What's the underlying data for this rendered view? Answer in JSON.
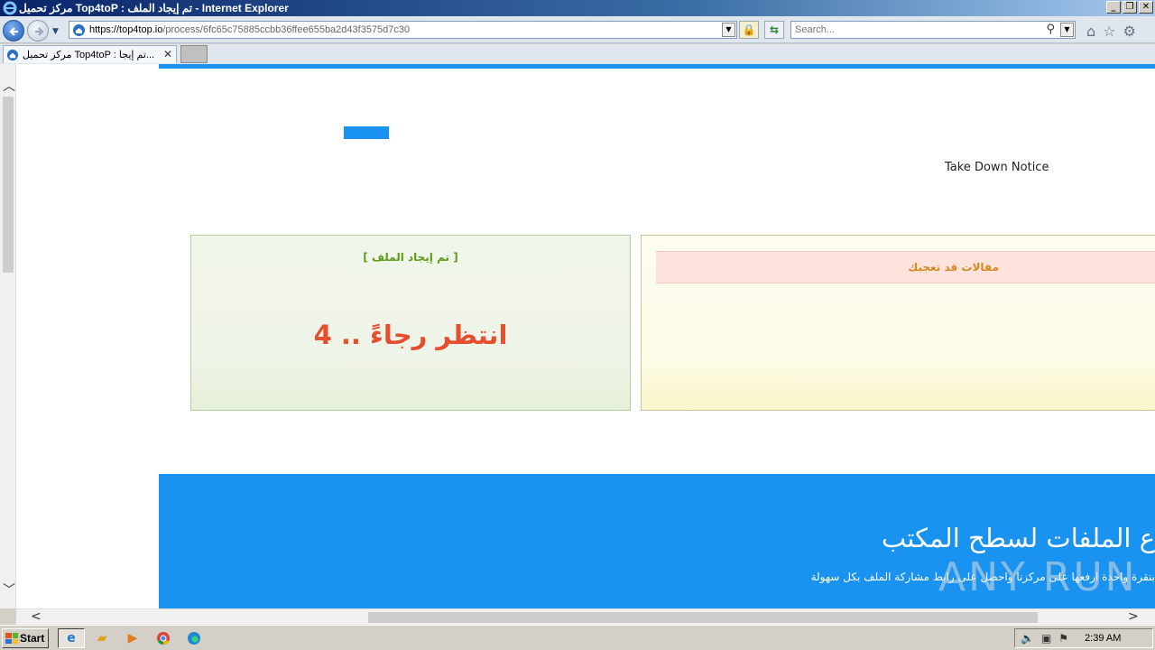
{
  "window": {
    "title": "مركز تحميل Top4toP : تم إيجاد الملف - Internet Explorer",
    "controls": [
      "_",
      "❐",
      "✕"
    ]
  },
  "toolbar": {
    "url_host": "https://top4top.io",
    "url_path": "/process/6fc65c75885ccbb36ffee655ba2d43f3575d7c30",
    "search_placeholder": "Search..."
  },
  "tabs": [
    {
      "label": "مركز تحميل Top4toP : تم إيجا..."
    }
  ],
  "page": {
    "take_down": "Take Down Notice",
    "file_found": "[ تم إيجاد الملف ]",
    "wait_text": "انتظر رجاءً .. 4",
    "articles_header": "مقالات قد تعجبك",
    "banner_title": "ع الملفات لسطح المكتب",
    "banner_subtitle": "بنقرة واحدة ارفعها على مركزنا واحصل على رابط مشاركة الملف بكل سهولة",
    "watermark": "ANY RUN"
  },
  "taskbar": {
    "start_label": "Start",
    "clock": "2:39 AM"
  },
  "colors": {
    "accent_blue": "#1a93f0",
    "found_green": "#5d9b1a",
    "wait_red": "#e4502f",
    "articles_orange": "#d68a22"
  }
}
